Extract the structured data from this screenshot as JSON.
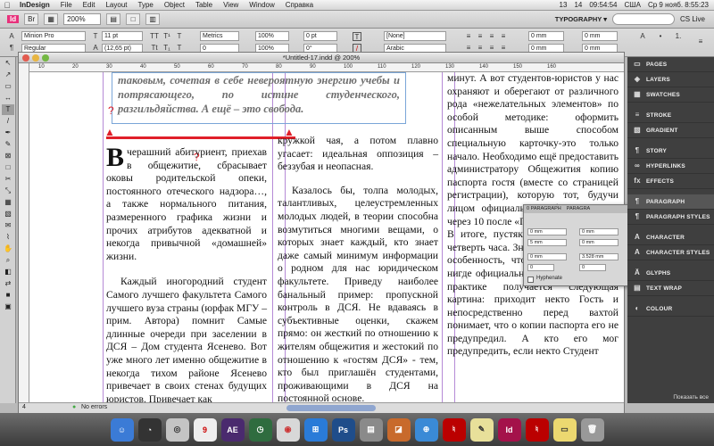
{
  "menubar": {
    "apple": "",
    "app_name": "InDesign",
    "items": [
      "File",
      "Edit",
      "Layout",
      "Type",
      "Object",
      "Table",
      "View",
      "Window",
      "Справка"
    ],
    "status": [
      "13",
      "14",
      "09:54:54",
      "США",
      "Ср 9 нояб.  8:55:23"
    ]
  },
  "appbar": {
    "logo": "Id",
    "zoom": "200%",
    "workspace": "TYPOGRAPHY ▾",
    "cs_live": "CS Live"
  },
  "control": {
    "font": "Minion Pro",
    "style": "Regular",
    "size": "11 pt",
    "leading": "(12,65 pt)",
    "kerning": "Metrics",
    "tracking": "0",
    "scale_v": "100%",
    "scale_h": "100%",
    "baseline": "0 pt",
    "skew": "0°",
    "char_style": "[None]",
    "language": "Arabic",
    "indent_l": "0 mm",
    "indent_r": "0 mm",
    "space_before": "0 mm",
    "space_after": "0 mm"
  },
  "document": {
    "title": "*Untitled-17.indd @ 200%",
    "ruler_marks": [
      "10",
      "20",
      "30",
      "40",
      "50",
      "60",
      "70",
      "80",
      "90",
      "100",
      "110",
      "120",
      "130",
      "140",
      "150",
      "160"
    ],
    "pull_quote": "таковым, сочетая в себе невероятную энергию учебы и потрясающего, по истине студенческого, разгильдяйства. А ещё – это свобода.",
    "col1": {
      "drop_cap": "В",
      "para1": "черашний абитуриент, приехав в общежитие, сбрасывает оковы родительской опеки, постоянного отеческого надзора…, а также нормального питания, размеренного графика жизни и прочих атрибутов адекватной и некогда привычной «домашней» жизни.",
      "para2": "Каждый иногородний студент Самого лучшего факультета Самого лучшего вуза страны (юрфак МГУ – прим. Автора) помнит Самые длинные очереди при заселении в ДСЯ – Дом студента Ясенево. Вот уже много лет именно общежитие в некогда тихом районе Ясенево привечает в своих стенах будущих юристов. Привечает как"
    },
    "col2": {
      "para1": "кружкой чая, а потом плавно угасает: идеальная оппозиция – беззубая и неопасная.",
      "para2": "Казалось бы, толпа молодых, талантливых, целеустремленных молодых людей, в теории способна возмутиться многими вещами, о которых знает каждый, кто знает даже самый минимум информации о родном для нас юридическом факультете. Приведу наиболее банальный пример: пропускной контроль в ДСЯ. Не вдаваясь в субъективные оценки, скажем прямо: он жесткий по отношению к жителям общежития и жестокий по отношению к «гостям ДСЯ» - тем, кто был приглашён студентами, проживающими в ДСЯ на постоянной основе."
    },
    "col3": {
      "para1": "минут. А вот студентов-юристов у нас охраняют и оберегают от различного рода «нежелательных элементов» по особой методике: оформить описанным выше способом специальную карточку-это только начало. Необходимо ещё предоставить администратору Общежития копию паспорта гостя (вместе со страницей регистрации), которую тот, будучи лицом официальным, будет хранить через 10 после «Подпишите,",
      "para2": "В итоге, пустяк растягивается в на четверть часа. Зная извечную русскую особенность, что подобный порядок нигде официально не прописан, то на практике получается следующая картина: приходит некто Гость и непосредственно перед вахтой понимает, что о копии паспорта его не предупредил. А кто его мог предупредить, если некто Студент"
    },
    "red_marks": [
      "?",
      "?"
    ],
    "status_errors": "No errors",
    "page_num": "4"
  },
  "panels": {
    "items": [
      "PAGES",
      "LAYERS",
      "SWATCHES",
      "STROKE",
      "GRADIENT",
      "STORY",
      "HYPERLINKS",
      "EFFECTS",
      "PARAGRAPH",
      "PARAGRAPH STYLES",
      "CHARACTER",
      "CHARACTER STYLES",
      "GLYPHS",
      "TEXT WRAP",
      "COLOUR"
    ],
    "show_all": "Показать все"
  },
  "para_panel": {
    "tab1": "0 PARAGRAPH",
    "tab2": "PARAGRA",
    "f1": "0 mm",
    "f2": "0 mm",
    "f3": "5 mm",
    "f4": "0 mm",
    "f5": "0 mm",
    "f6": "3.528 mm",
    "f7": "0",
    "f8": "0",
    "hyphenate": "Hyphenate"
  },
  "dock": [
    "Finder",
    "Dashboard",
    "Chrome",
    "9",
    "AE",
    "Time Machine",
    "Chrome",
    "Windows",
    "Ps",
    "Files",
    "Preview",
    "Safari",
    "Acrobat",
    "Notes",
    "Id",
    "Acrobat",
    "Stickies",
    "Trash"
  ]
}
